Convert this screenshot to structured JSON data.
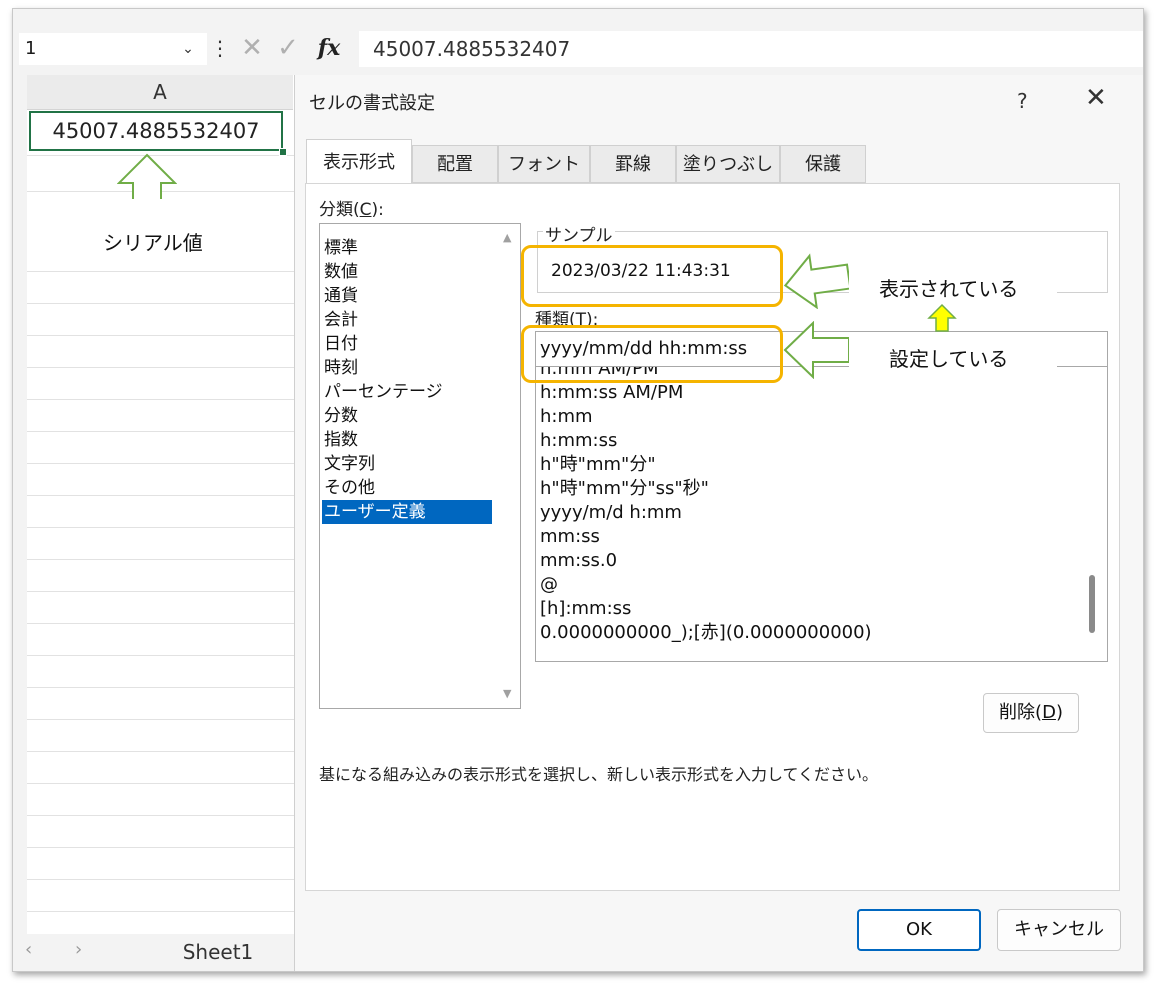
{
  "formula_bar": {
    "name_box": "1",
    "dropdown_icon": "chevron-down-icon",
    "more_icon": "more-vertical-icon",
    "cancel_icon": "✕",
    "enter_icon": "✓",
    "fx_label": "fx",
    "formula_value": "45007.4885532407"
  },
  "sheet": {
    "column_header": "A",
    "cell_a1": "45007.4885532407",
    "tab_name": "Sheet1",
    "nav_prev": "‹",
    "nav_next": "›"
  },
  "annotations": {
    "serial": "シリアル値",
    "displayed": "表示されている",
    "configured": "設定している"
  },
  "dialog": {
    "title": "セルの書式設定",
    "help": "?",
    "close": "✕",
    "tabs": [
      "表示形式",
      "配置",
      "フォント",
      "罫線",
      "塗りつぶし",
      "保護"
    ],
    "category_label": "分類(C):",
    "category_label_parts": [
      "分類(",
      "C",
      "):"
    ],
    "categories": [
      "標準",
      "数値",
      "通貨",
      "会計",
      "日付",
      "時刻",
      "パーセンテージ",
      "分数",
      "指数",
      "文字列",
      "その他",
      "ユーザー定義"
    ],
    "selected_category": "ユーザー定義",
    "sample_label": "サンプル",
    "sample_value": "2023/03/22 11:43:31",
    "type_label_parts": [
      "種類(",
      "T",
      "):"
    ],
    "type_value": "yyyy/mm/dd hh:mm:ss",
    "formats": [
      "h:mm AM/PM",
      "h:mm:ss AM/PM",
      "h:mm",
      "h:mm:ss",
      "h\"時\"mm\"分\"",
      "h\"時\"mm\"分\"ss\"秒\"",
      "yyyy/m/d h:mm",
      "mm:ss",
      "mm:ss.0",
      "@",
      "[h]:mm:ss",
      "0.0000000000_);[赤](0.0000000000)"
    ],
    "delete_parts": [
      "削除(",
      "D",
      ")"
    ],
    "description": "基になる組み込みの表示形式を選択し、新しい表示形式を入力してください。",
    "ok": "OK",
    "cancel": "キャンセル"
  },
  "colors": {
    "selection": "#0067c0",
    "cell_border": "#217346",
    "highlight": "#f5b400",
    "arrow_green": "#70ad47",
    "arrow_yellow": "#ffff00"
  }
}
